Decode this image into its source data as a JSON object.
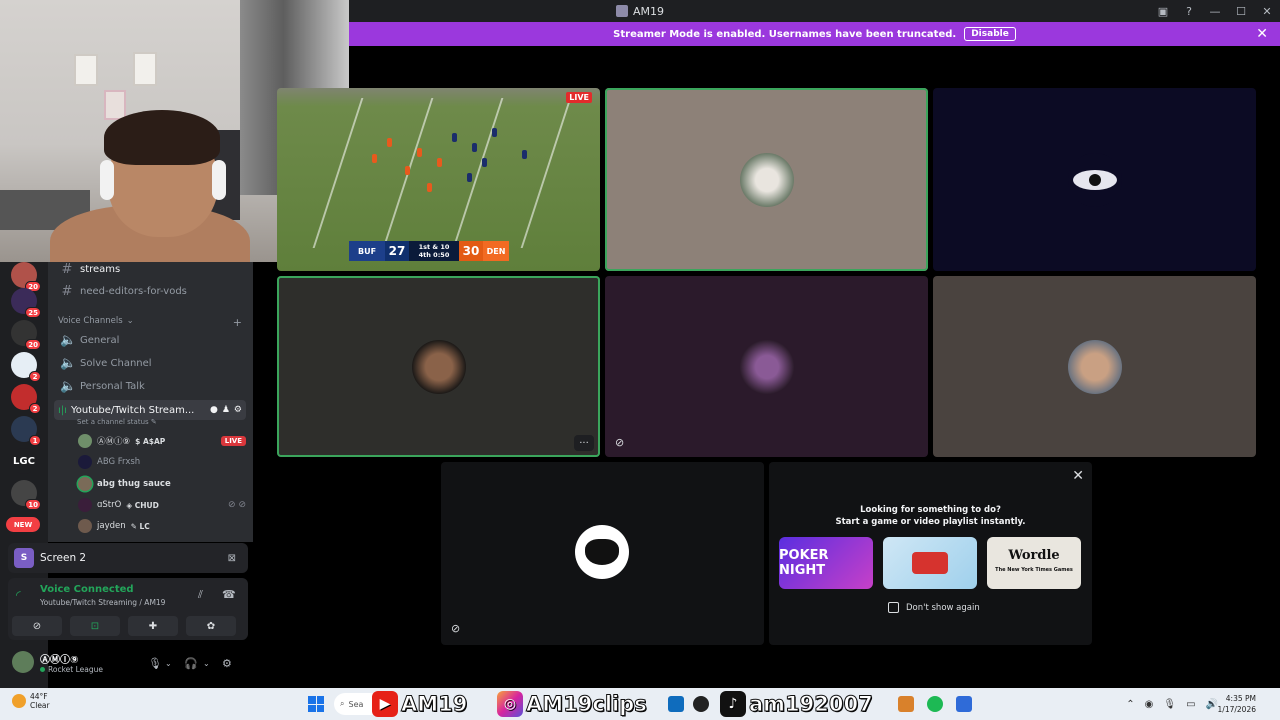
{
  "window": {
    "title": "AM19"
  },
  "banner": {
    "message": "Streamer Mode is enabled. Usernames have been truncated.",
    "disable_label": "Disable"
  },
  "servers": [
    {
      "badge": "20"
    },
    {
      "badge": "25"
    },
    {
      "badge": "20"
    },
    {
      "badge": "2"
    },
    {
      "badge": "2"
    },
    {
      "badge": "1"
    },
    {
      "label": "LGC"
    },
    {
      "badge": "10"
    }
  ],
  "new_pill": "NEW",
  "channels": {
    "text": [
      "streams",
      "need-editors-for-vods"
    ],
    "voice_category": "Voice Channels",
    "voice": [
      "General",
      "Solve Channel",
      "Personal Talk"
    ],
    "active_voice": "Youtube/Twitch Stream...",
    "channel_status_placeholder": "Set a channel status"
  },
  "members": [
    {
      "name": "ⒶⓂⒾ⑨",
      "activity": "A$AP",
      "live": "LIVE"
    },
    {
      "name": "ABG Frxsh"
    },
    {
      "name": "abg thug sauce"
    },
    {
      "name": "ɑStrO",
      "activity": "CHUD"
    },
    {
      "name": "jayden",
      "activity": "LC"
    }
  ],
  "screen_share": {
    "label": "Screen 2",
    "icon_letter": "S"
  },
  "voice_panel": {
    "status": "Voice Connected",
    "location": "Youtube/Twitch Streaming / AM19"
  },
  "user_panel": {
    "name": "ⒶⓂⒾ⑨",
    "activity": "Rocket League"
  },
  "stream": {
    "live_label": "LIVE",
    "home_abbr": "BUF",
    "home_score": "27",
    "down_distance": "1st & 10",
    "quarter": "4th",
    "clock": "0:50",
    "away_abbr": "DEN",
    "away_score": "30"
  },
  "activity_prompt": {
    "line1": "Looking for something to do?",
    "line2": "Start a game or video playlist instantly.",
    "games": [
      "POKER NIGHT",
      "",
      "Wordle"
    ],
    "wordle_sub": "The New York Times Games",
    "dont_show": "Don't show again"
  },
  "taskbar": {
    "temp": "44°F",
    "weather": "Clear",
    "search_label": "Sea",
    "overlay_youtube": "AM19",
    "overlay_instagram": "AM19clips",
    "overlay_tiktok": "am192007",
    "time": "4:35 PM",
    "date": "1/17/2026"
  },
  "colors": {
    "banner": "#9b38dd",
    "speaking": "#3ba55c",
    "live": "#da373c",
    "voice_connected": "#23a55a"
  }
}
